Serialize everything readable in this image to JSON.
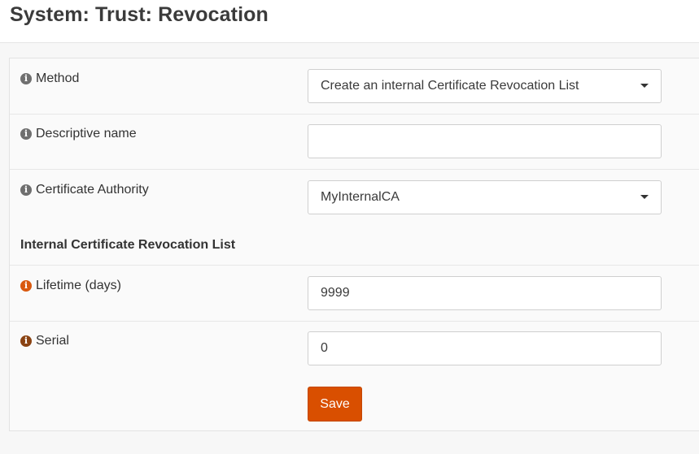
{
  "header": {
    "title": "System: Trust: Revocation"
  },
  "form": {
    "method": {
      "label": "Method",
      "value": "Create an internal Certificate Revocation List"
    },
    "descriptive_name": {
      "label": "Descriptive name",
      "value": ""
    },
    "certificate_authority": {
      "label": "Certificate Authority",
      "value": "MyInternalCA"
    },
    "section_title": "Internal Certificate Revocation List",
    "lifetime": {
      "label": "Lifetime (days)",
      "value": "9999"
    },
    "serial": {
      "label": "Serial",
      "value": "0"
    },
    "save_label": "Save"
  },
  "colors": {
    "info_default": "#6f6f6f",
    "info_lifetime": "#d9590f",
    "info_serial": "#8a4313",
    "save_button": "#d94f00"
  },
  "icons": {
    "info": "info-circle-icon",
    "select": "chevron-down-icon"
  }
}
